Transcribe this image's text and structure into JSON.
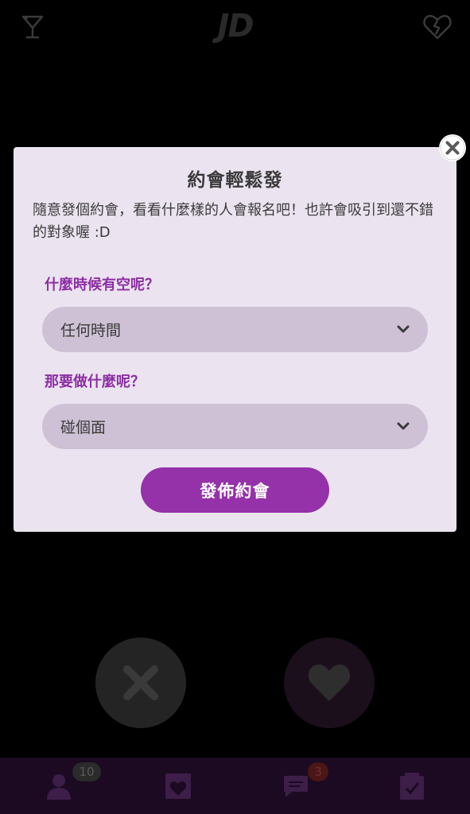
{
  "header": {
    "logo": "JD",
    "left_icon": "cocktail-icon",
    "right_icon": "broken-heart-icon"
  },
  "dialog": {
    "title": "約會輕鬆發",
    "description": "隨意發個約會，看看什麼樣的人會報名吧！也許會吸引到還不錯的對象喔 :D",
    "time_label": "什麼時候有空呢？",
    "time_value": "任何時間",
    "activity_label": "那要做什麼呢？",
    "activity_value": "碰個面",
    "submit_label": "發佈約會",
    "close_icon": "close-icon"
  },
  "actions": {
    "reject_icon": "x-icon",
    "like_icon": "heart-icon"
  },
  "bottom_nav": {
    "items": [
      {
        "icon": "user-icon",
        "badge": "10"
      },
      {
        "icon": "heart-card-icon"
      },
      {
        "icon": "chat-icon",
        "badge": "3"
      },
      {
        "icon": "calendar-check-icon"
      }
    ]
  },
  "colors": {
    "accent": "#9531a9",
    "label": "#8c2fa3",
    "dialog_bg": "#ebe3f0",
    "select_bg": "#cec1d5",
    "nav_bg": "#1b0a22"
  }
}
